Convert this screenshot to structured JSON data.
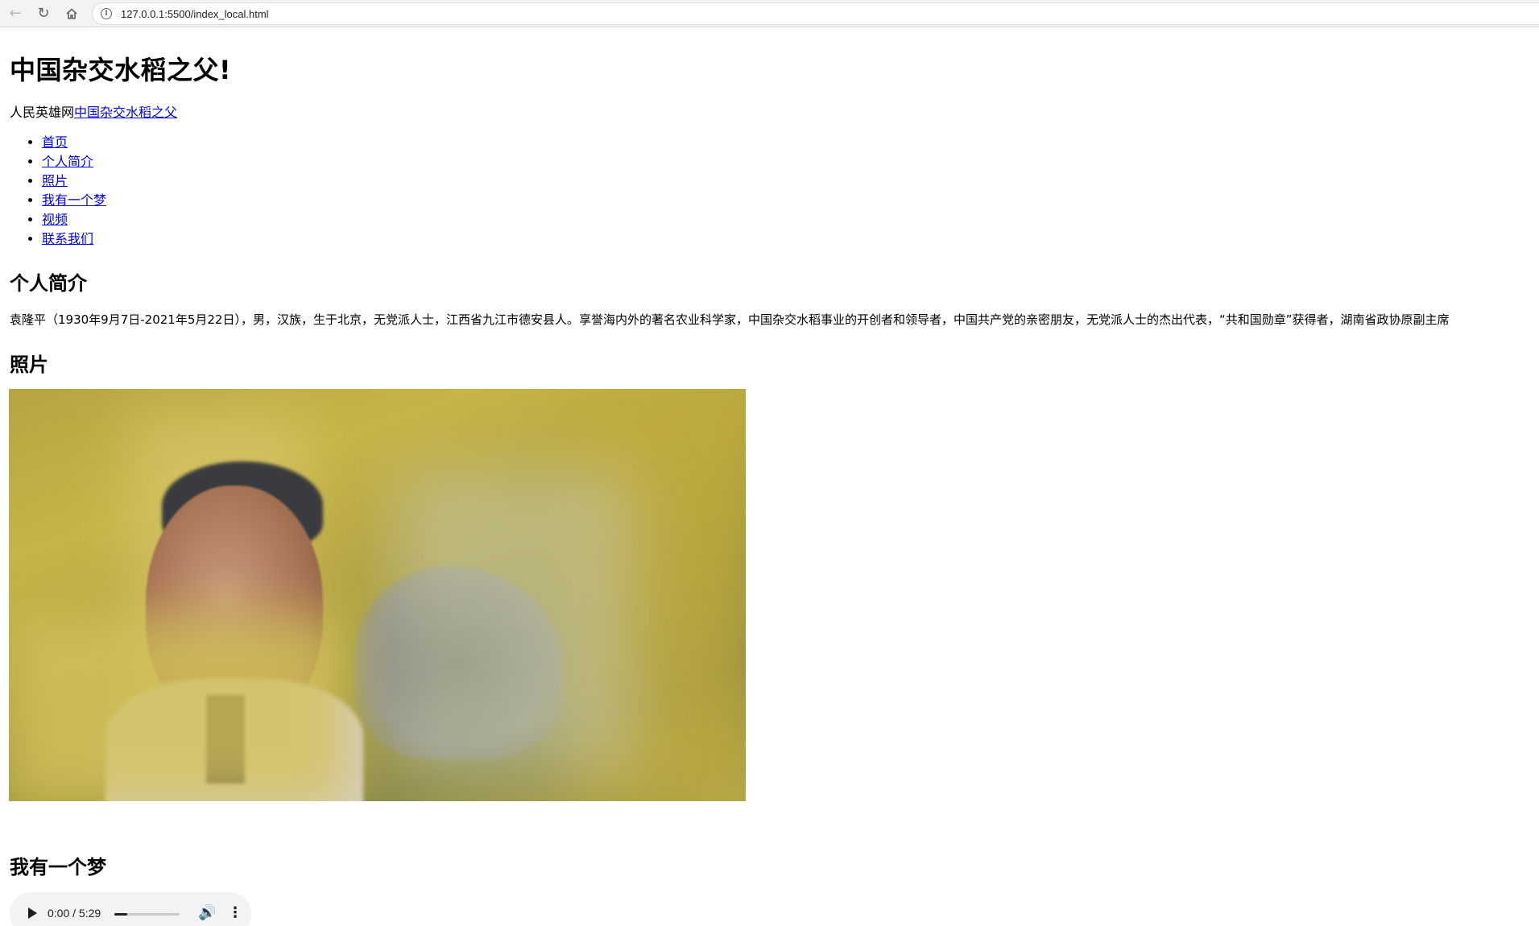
{
  "browser": {
    "url": "127.0.0.1:5500/index_local.html"
  },
  "page": {
    "title": "中国杂交水稻之父!",
    "subtitle": {
      "prefix": "人民英雄网",
      "link": "中国杂交水稻之父"
    },
    "nav": [
      "首页",
      "个人简介",
      "照片",
      "我有一个梦",
      "视频",
      "联系我们"
    ],
    "sections": {
      "intro": {
        "heading": "个人简介",
        "text": "袁隆平（1930年9月7日-2021年5月22日），男，汉族，生于北京，无党派人士，江西省九江市德安县人。享誉海内外的著名农业科学家，中国杂交水稻事业的开创者和领导者，中国共产党的亲密朋友，无党派人士的杰出代表，“共和国勋章”获得者，湖南省政协原副主席"
      },
      "photos": {
        "heading": "照片"
      },
      "dream": {
        "heading": "我有一个梦",
        "audio": {
          "time": "0:00 / 5:29",
          "buffered_fraction": 0.2
        }
      }
    }
  },
  "icons": {
    "back": "back-arrow-icon",
    "reload": "reload-icon",
    "home": "home-icon",
    "site_info": "info-icon",
    "play": "play-icon",
    "volume": "volume-icon",
    "more": "more-vertical-icon"
  }
}
